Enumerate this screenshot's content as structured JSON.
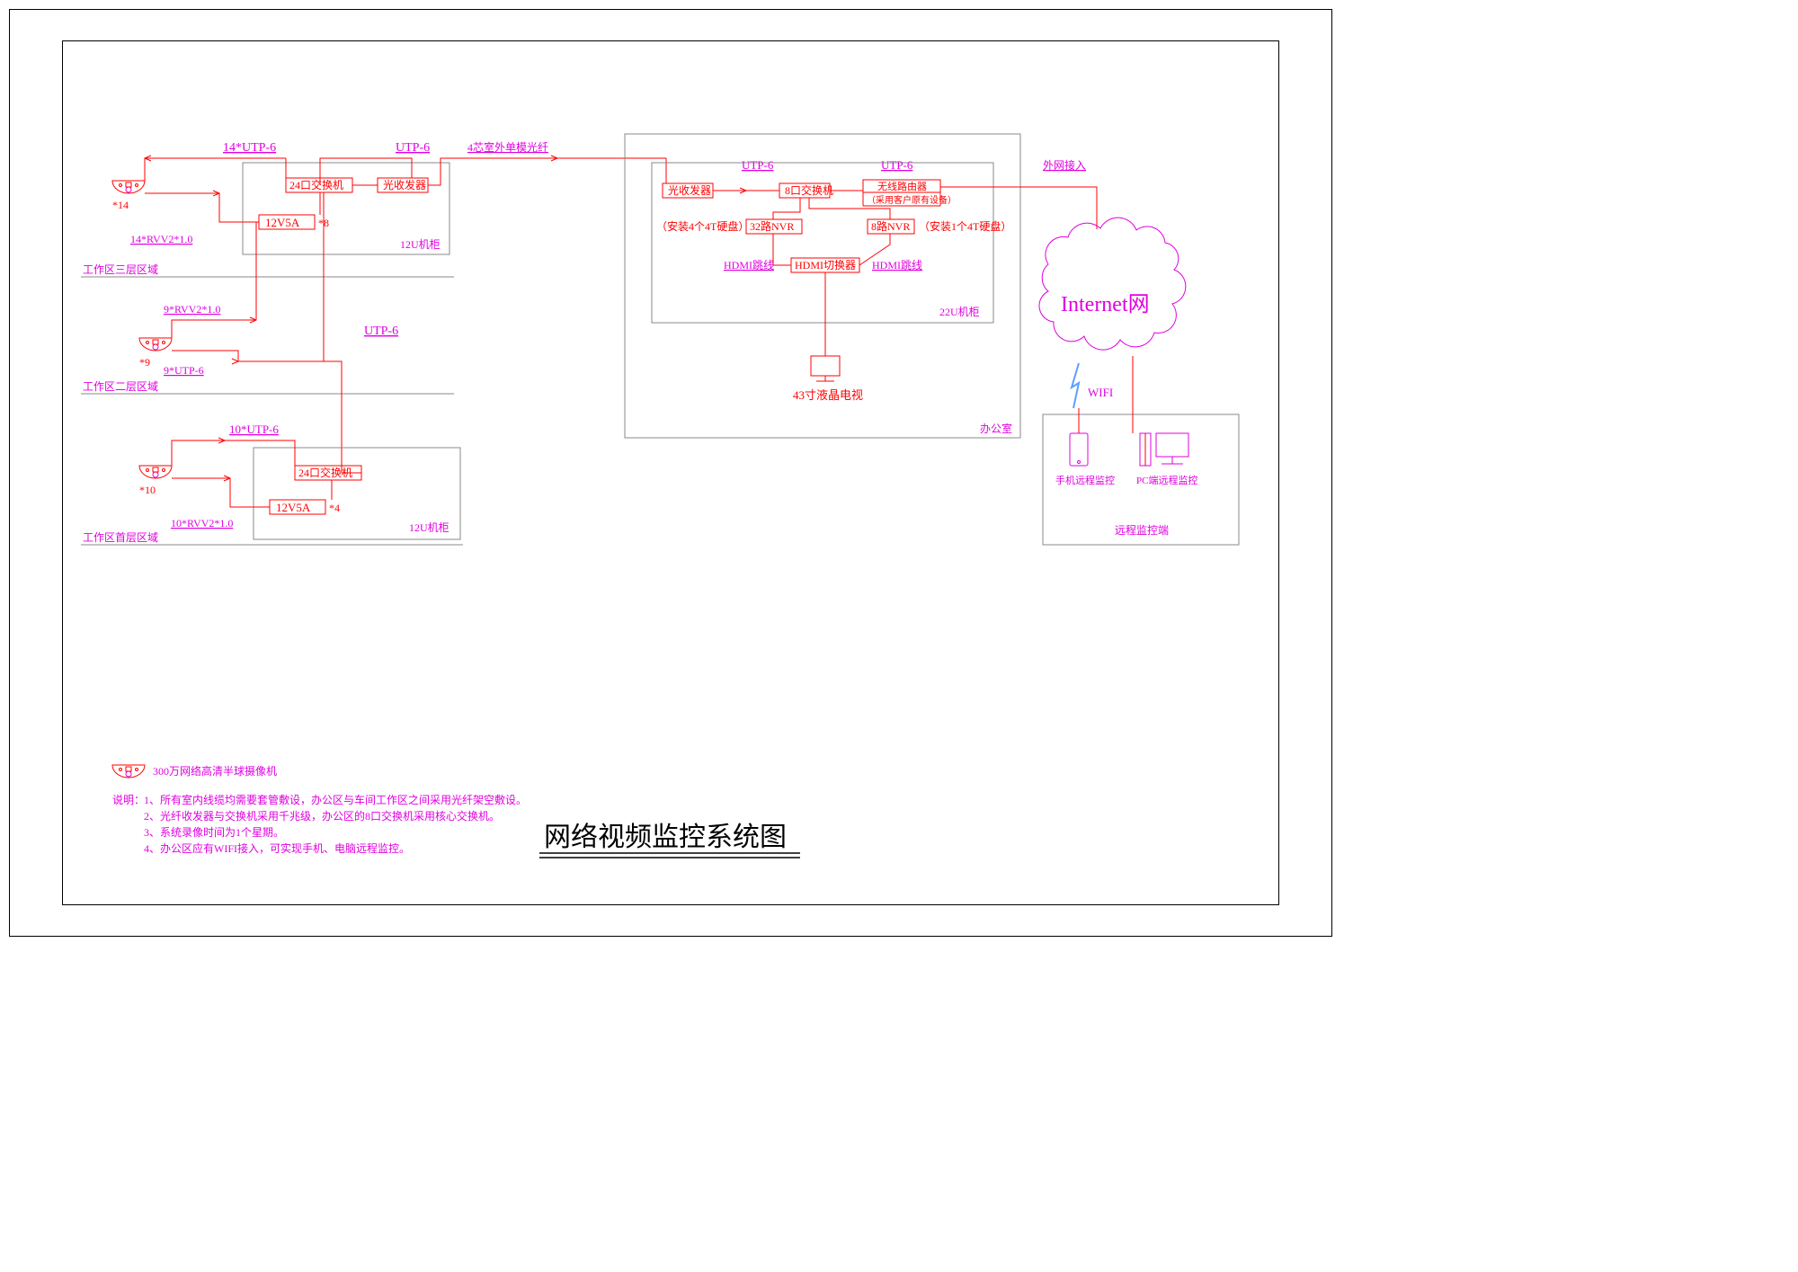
{
  "title": "网络视频监控系统图",
  "legend": {
    "camera": "300万网络高清半球摄像机",
    "noteLabel": "说明：",
    "notes": [
      "1、所有室内线缆均需要套管敷设，办公区与车间工作区之间采用光纤架空敷设。",
      "2、光纤收发器与交换机采用千兆级，办公区的8口交换机采用核心交换机。",
      "3、系统录像时间为1个星期。",
      "4、办公区应有WIFI接入，可实现手机、电脑远程监控。"
    ]
  },
  "zone3": {
    "camCount": "*14",
    "cable1": "14*UTP-6",
    "cable2": "14*RVV2*1.0",
    "switch": "24口交换机",
    "power": "12V5A",
    "powerMult": "*8",
    "trx": "光收发器",
    "cabinet": "12U机柜",
    "utp": "UTP-6",
    "fiber": "4芯室外单模光纤",
    "label": "工作区三层区域"
  },
  "zone2": {
    "camCount": "*9",
    "cable1": "9*RVV2*1.0",
    "cable2": "9*UTP-6",
    "utp": "UTP-6",
    "label": "工作区二层区域"
  },
  "zone1": {
    "camCount": "*10",
    "cable1": "10*UTP-6",
    "cable2": "10*RVV2*1.0",
    "switch": "24口交换机",
    "power": "12V5A",
    "powerMult": "*4",
    "cabinet": "12U机柜",
    "label": "工作区首层区域"
  },
  "office": {
    "trx": "光收发器",
    "switch": "8口交换机",
    "router": "无线路由器",
    "routerNote": "（采用客户原有设备）",
    "nvr32": "32路NVR",
    "nvr32Note": "（安装4个4T硬盘）",
    "nvr8": "8路NVR",
    "nvr8Note": "（安装1个4T硬盘）",
    "hdmiL": "HDMI跳线",
    "hdmiSw": "HDMI切换器",
    "hdmiR": "HDMI跳线",
    "tv": "43寸液晶电视",
    "cabinet": "22U机柜",
    "label": "办公室",
    "utp1": "UTP-6",
    "utp2": "UTP-6",
    "wan": "外网接入"
  },
  "remote": {
    "cloud": "Internet网",
    "wifi": "WIFI",
    "phone": "手机远程监控",
    "pc": "PC端远程监控",
    "label": "远程监控端"
  }
}
